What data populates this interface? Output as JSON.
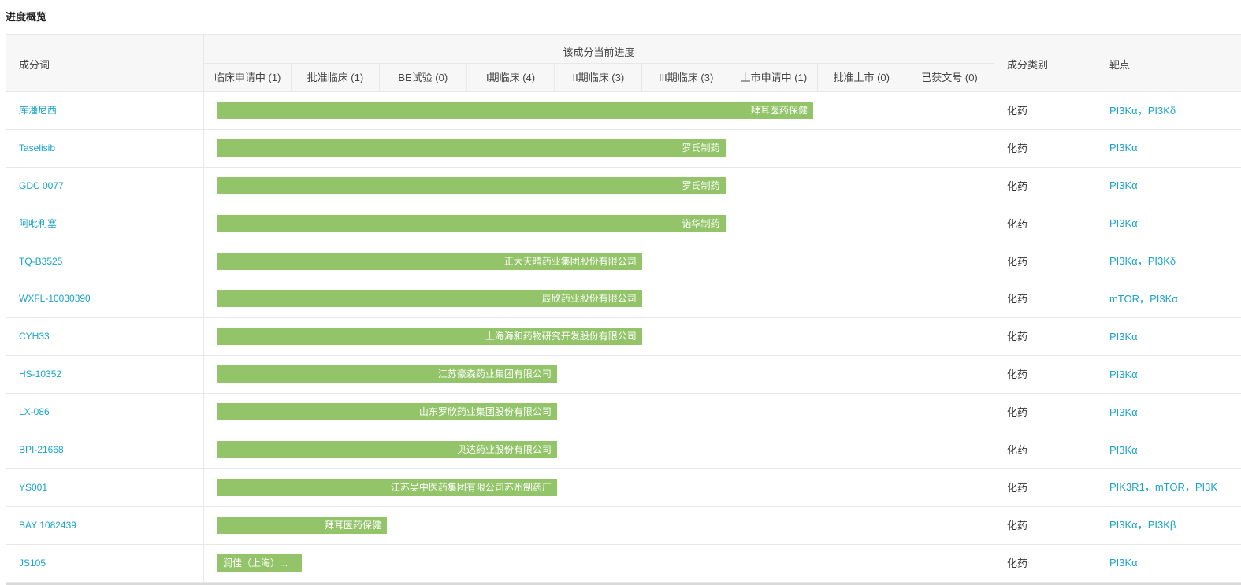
{
  "title": "进度概览",
  "header": {
    "name": "成分词",
    "progress": "该成分当前进度",
    "category": "成分类别",
    "target": "靶点",
    "stages": [
      "临床申请中 (1)",
      "批准临床 (1)",
      "BE试验 (0)",
      "I期临床 (4)",
      "II期临床 (3)",
      "III期临床 (3)",
      "上市申请中 (1)",
      "批准上市 (0)",
      "已获文号 (0)"
    ]
  },
  "colors": {
    "bar": "#93c46a",
    "link": "#1aa3c9",
    "header_bg": "#f7f7f7",
    "border": "#e8e8e8"
  },
  "rows": [
    {
      "name": "库潘尼西",
      "company": "拜耳医药保健",
      "stage_progress": 6.8,
      "category": "化药",
      "targets": [
        "PI3Kα",
        "PI3Kδ"
      ]
    },
    {
      "name": "Taselisib",
      "company": "罗氏制药",
      "stage_progress": 5.8,
      "category": "化药",
      "targets": [
        "PI3Kα"
      ]
    },
    {
      "name": "GDC 0077",
      "company": "罗氏制药",
      "stage_progress": 5.8,
      "category": "化药",
      "targets": [
        "PI3Kα"
      ]
    },
    {
      "name": "阿吡利塞",
      "company": "诺华制药",
      "stage_progress": 5.8,
      "category": "化药",
      "targets": [
        "PI3Kα"
      ]
    },
    {
      "name": "TQ-B3525",
      "company": "正大天晴药业集团股份有限公司",
      "stage_progress": 4.85,
      "category": "化药",
      "targets": [
        "PI3Kα",
        "PI3Kδ"
      ]
    },
    {
      "name": "WXFL-10030390",
      "company": "辰欣药业股份有限公司",
      "stage_progress": 4.85,
      "category": "化药",
      "targets": [
        "mTOR",
        "PI3Kα"
      ]
    },
    {
      "name": "CYH33",
      "company": "上海海和药物研究开发股份有限公司",
      "stage_progress": 4.85,
      "category": "化药",
      "targets": [
        "PI3Kα"
      ]
    },
    {
      "name": "HS-10352",
      "company": "江苏豪森药业集团有限公司",
      "stage_progress": 3.88,
      "category": "化药",
      "targets": [
        "PI3Kα"
      ]
    },
    {
      "name": "LX-086",
      "company": "山东罗欣药业集团股份有限公司",
      "stage_progress": 3.88,
      "category": "化药",
      "targets": [
        "PI3Kα"
      ]
    },
    {
      "name": "BPI-21668",
      "company": "贝达药业股份有限公司",
      "stage_progress": 3.88,
      "category": "化药",
      "targets": [
        "PI3Kα"
      ]
    },
    {
      "name": "YS001",
      "company": "江苏吴中医药集团有限公司苏州制药厂",
      "stage_progress": 3.88,
      "category": "化药",
      "targets": [
        "PIK3R1",
        "mTOR",
        "PI3K"
      ]
    },
    {
      "name": "BAY 1082439",
      "company": "拜耳医药保健",
      "stage_progress": 1.94,
      "category": "化药",
      "targets": [
        "PI3Kα",
        "PI3Kβ"
      ]
    },
    {
      "name": "JS105",
      "company": "润佳（上海）...",
      "stage_progress": 0.97,
      "category": "化药",
      "targets": [
        "PI3Kα"
      ]
    }
  ]
}
